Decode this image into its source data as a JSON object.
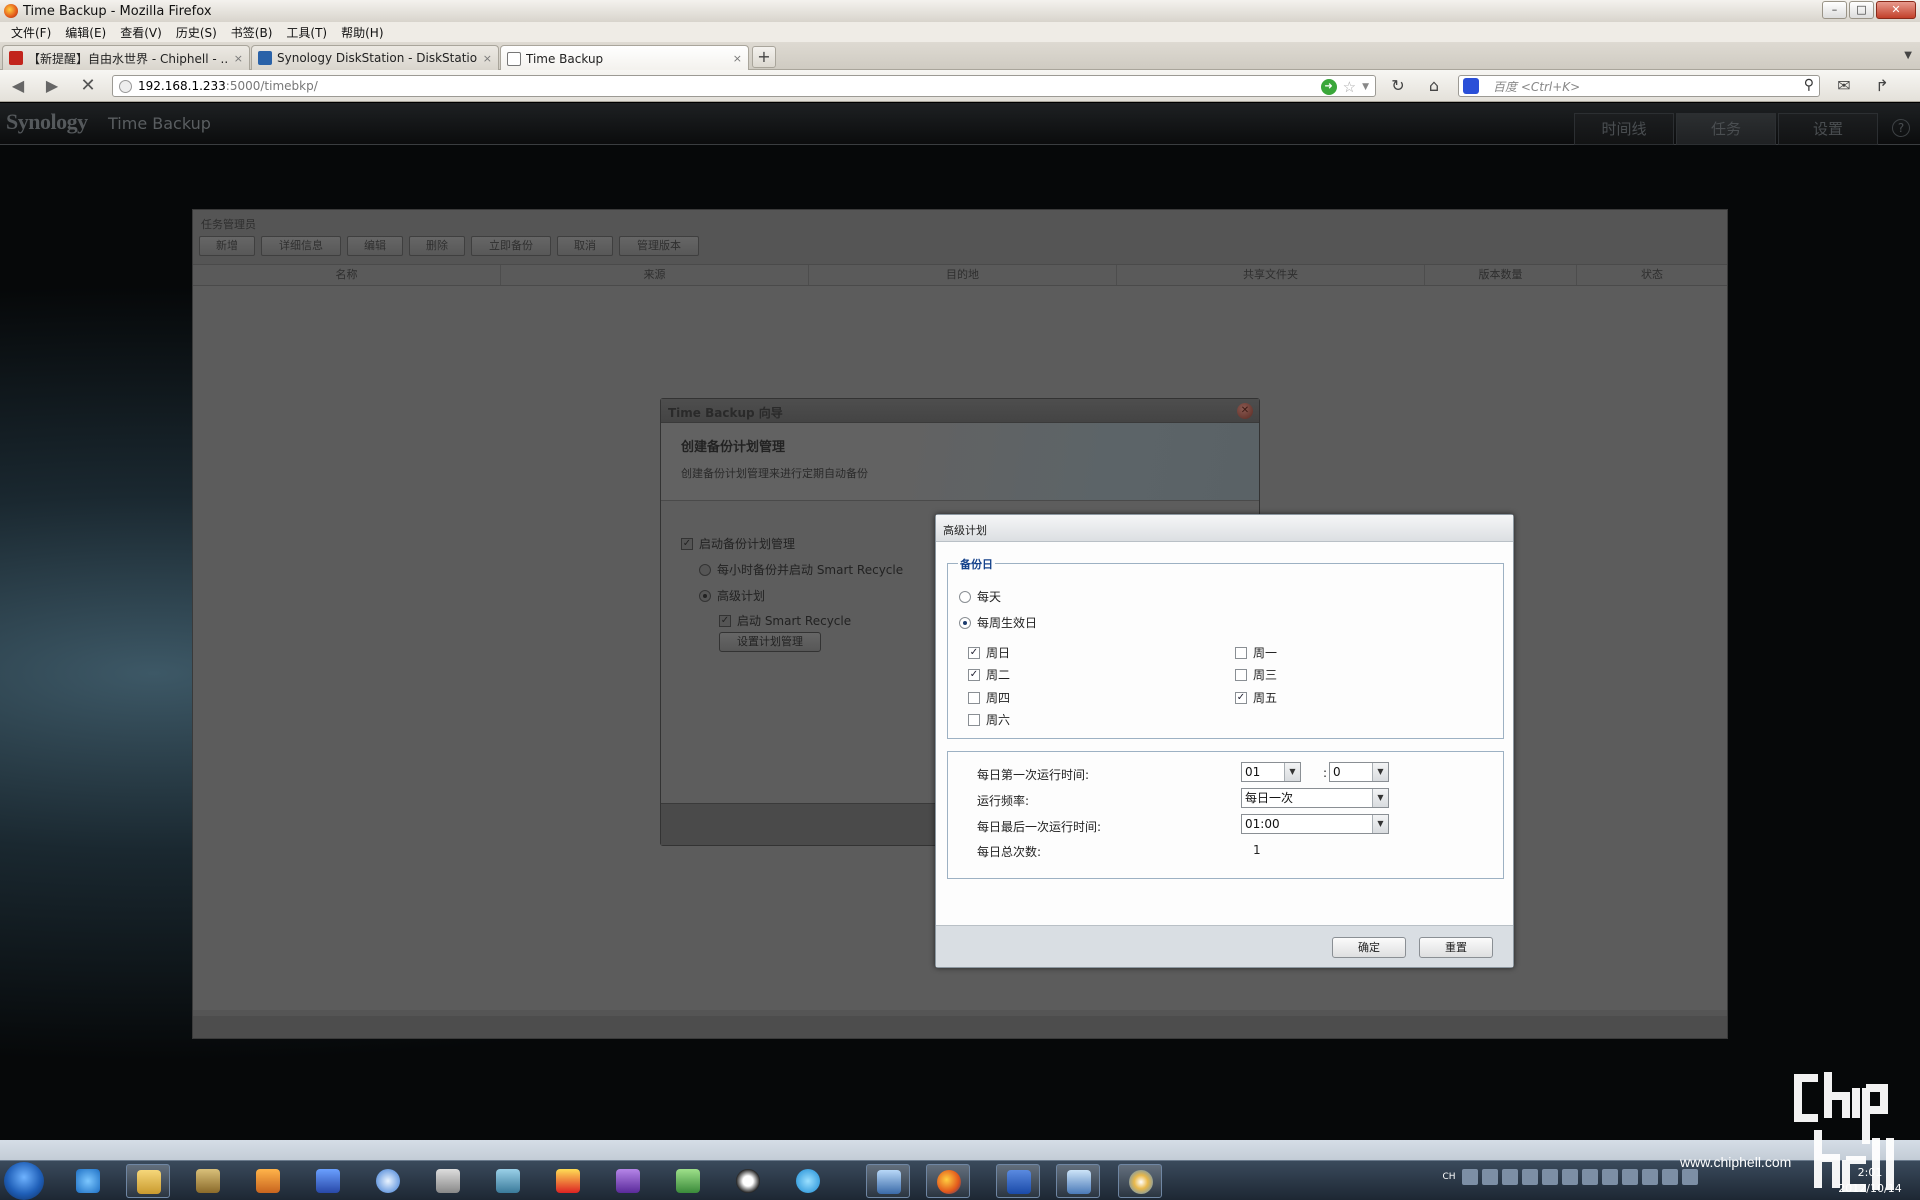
{
  "window": {
    "title": "Time Backup - Mozilla Firefox"
  },
  "window_buttons": {
    "min": "–",
    "max": "□",
    "close": "✕"
  },
  "menus": [
    "文件(F)",
    "编辑(E)",
    "查看(V)",
    "历史(S)",
    "书签(B)",
    "工具(T)",
    "帮助(H)"
  ],
  "tabs": [
    {
      "label": "【新提醒】自由水世界 - Chiphell - ...",
      "close": "×",
      "favicon_color": "#c2241c"
    },
    {
      "label": "Synology DiskStation - DiskStation",
      "close": "×",
      "favicon_color": "#2a62a8"
    },
    {
      "label": "Time Backup",
      "close": "×",
      "favicon_color": "#777777"
    }
  ],
  "new_tab_label": "+",
  "address": {
    "host": "192.168.1.233",
    "path": ":5000/timebkp/"
  },
  "search": {
    "placeholder": "百度 <Ctrl+K>"
  },
  "dsm": {
    "logo": "Synology",
    "app_name": "Time Backup",
    "nav_tabs": [
      "时间线",
      "任务",
      "设置"
    ],
    "help": "?"
  },
  "task_manager": {
    "title": "任务管理员",
    "toolbar": [
      "新增",
      "详细信息",
      "编辑",
      "删除",
      "立即备份",
      "取消",
      "管理版本"
    ],
    "columns": [
      "名称",
      "来源",
      "目的地",
      "共享文件夹",
      "版本数量",
      "状态"
    ]
  },
  "wizard": {
    "title": "Time Backup 向导",
    "heading": "创建备份计划管理",
    "subheading": "创建备份计划管理来进行定期自动备份",
    "enable_schedule": {
      "label": "启动备份计划管理",
      "checked": true
    },
    "option_hourly": {
      "label": "每小时备份并启动 Smart Recycle",
      "selected": false
    },
    "option_advanced": {
      "label": "高级计划",
      "selected": true
    },
    "enable_smart_recycle": {
      "label": "启动 Smart Recycle",
      "checked": true
    },
    "set_schedule_button": "设置计划管理"
  },
  "advanced_plan": {
    "title": "高级计划",
    "backup_days_legend": "备份日",
    "option_daily": {
      "label": "每天",
      "selected": false
    },
    "option_weekly": {
      "label": "每周生效日",
      "selected": true
    },
    "days": [
      {
        "label": "周日",
        "checked": true
      },
      {
        "label": "周一",
        "checked": false
      },
      {
        "label": "周二",
        "checked": true
      },
      {
        "label": "周三",
        "checked": false
      },
      {
        "label": "周四",
        "checked": false
      },
      {
        "label": "周五",
        "checked": true
      },
      {
        "label": "周六",
        "checked": false
      }
    ],
    "first_run_label": "每日第一次运行时间:",
    "first_run_hour": "01",
    "first_run_minute": "0",
    "time_separator": ":",
    "frequency_label": "运行频率:",
    "frequency_value": "每日一次",
    "last_run_label": "每日最后一次运行时间:",
    "last_run_value": "01:00",
    "total_runs_label": "每日总次数:",
    "total_runs_value": "1",
    "ok_button": "确定",
    "reset_button": "重置"
  },
  "taskbar": {
    "clock_time": "2:01",
    "clock_date": "2012/10/14",
    "tray_lang": "CH"
  },
  "watermark": {
    "url": "www.chiphell.com"
  }
}
